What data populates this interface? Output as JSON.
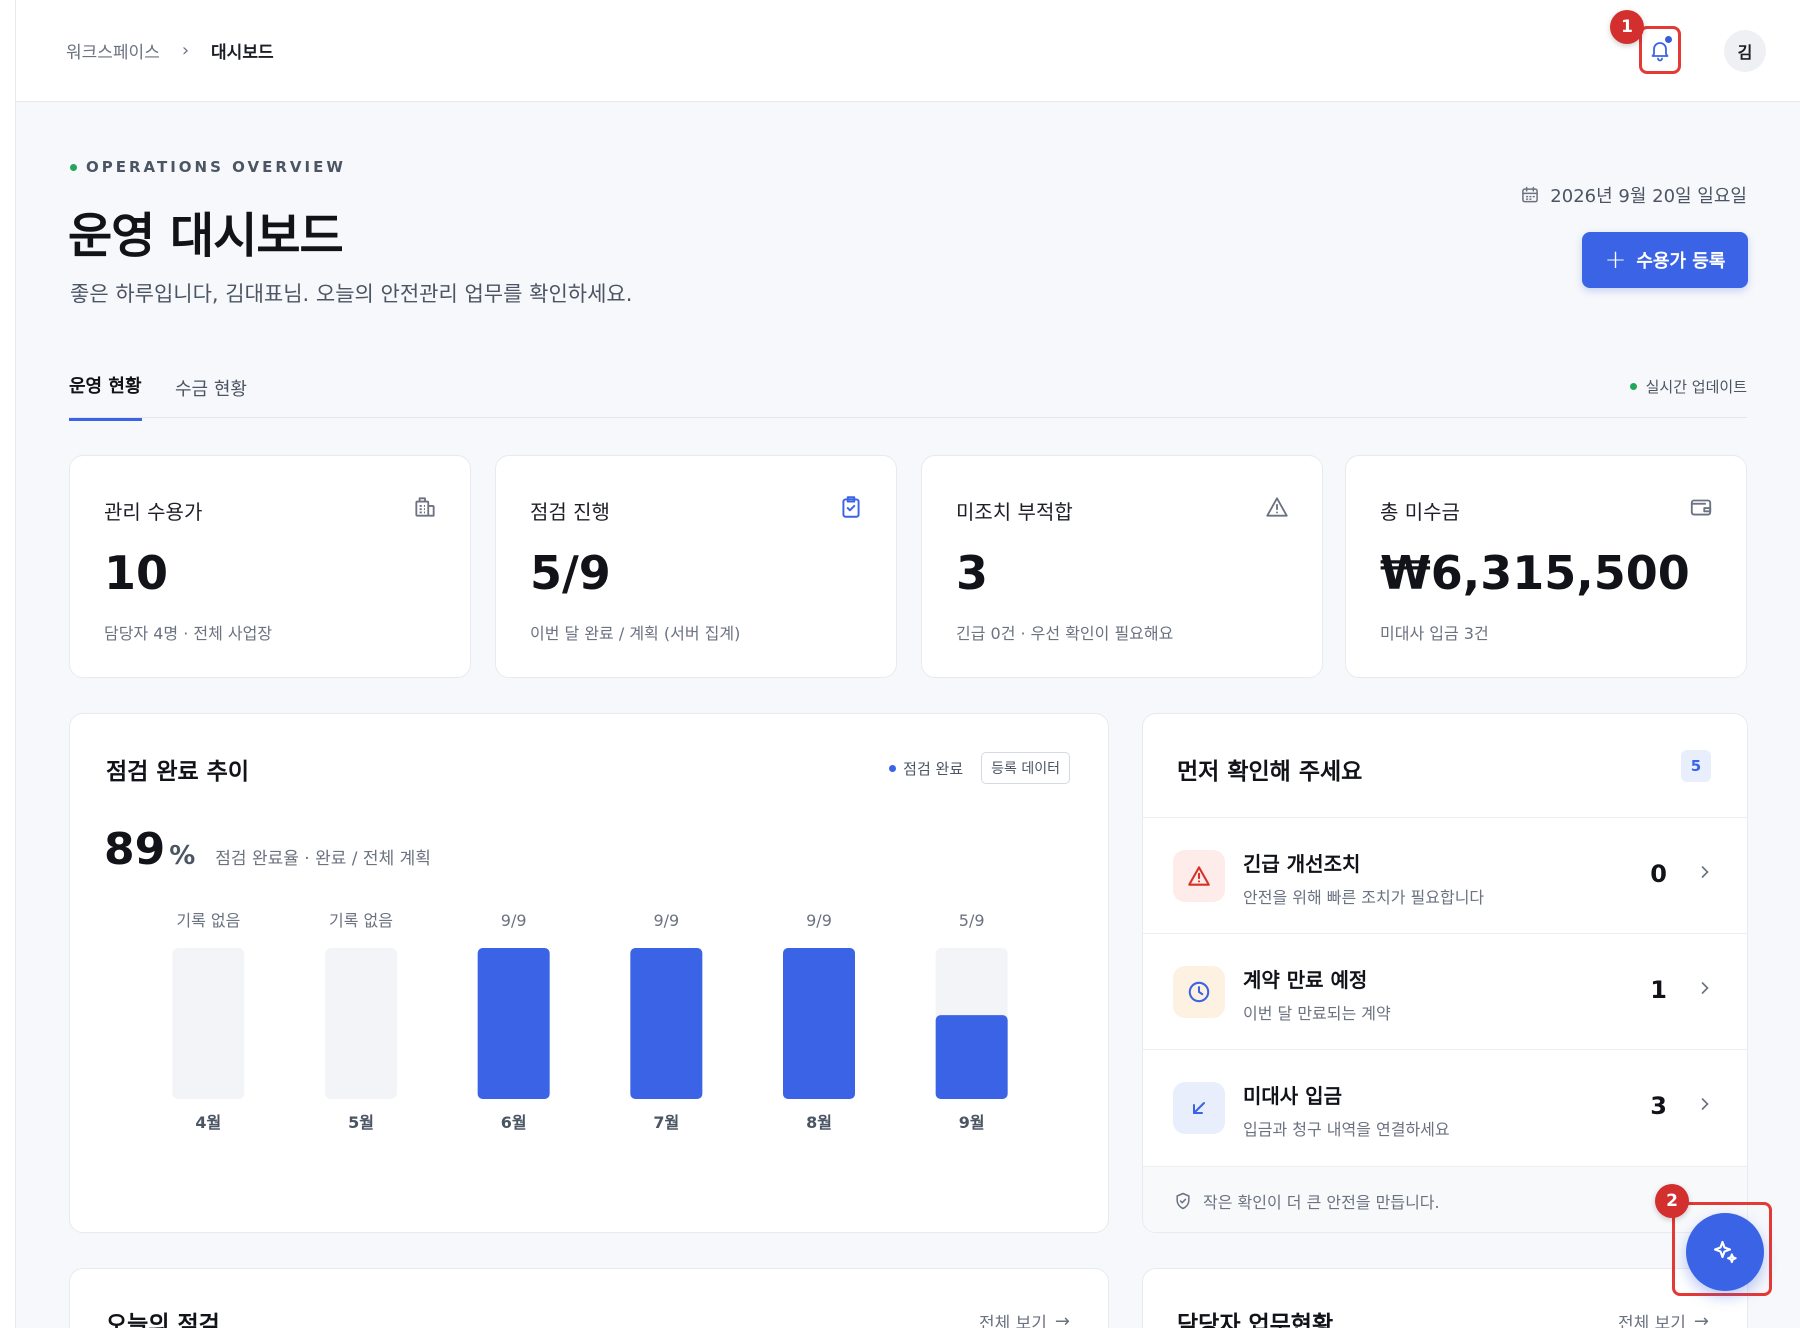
{
  "breadcrumb": {
    "root": "워크스페이스",
    "separator": "›",
    "current": "대시보드"
  },
  "header": {
    "avatar_initial": "김"
  },
  "markers": {
    "first": "1",
    "second": "2"
  },
  "hero": {
    "eyebrow": "OPERATIONS OVERVIEW",
    "title": "운영 대시보드",
    "greeting": "좋은 하루입니다, 김대표님. 오늘의 안전관리 업무를 확인하세요.",
    "date": "2026년 9월 20일 일요일",
    "primary_button": "수용가 등록"
  },
  "tabs": [
    {
      "label": "운영 현황",
      "active": true
    },
    {
      "label": "수금 현황",
      "active": false
    }
  ],
  "live_status": "실시간 업데이트",
  "stats": [
    {
      "label": "관리 수용가",
      "value": "10",
      "sub": "담당자 4명 · 전체 사업장",
      "icon": "building-icon"
    },
    {
      "label": "점검 진행",
      "value": "5/9",
      "sub": "이번 달 완료 / 계획 (서버 집계)",
      "icon": "clipboard-check-icon"
    },
    {
      "label": "미조치 부적합",
      "value": "3",
      "sub": "긴급 0건 · 우선 확인이 필요해요",
      "icon": "warning-icon"
    },
    {
      "label": "총 미수금",
      "value": "₩6,315,500",
      "sub": "미대사 입금 3건",
      "icon": "wallet-icon"
    }
  ],
  "chart_panel": {
    "title": "점검 완료 추이",
    "legend_label": "점검 완료",
    "tag": "등록 데이터",
    "rate_value": "89",
    "rate_unit": "%",
    "rate_desc": "점검 완료율 · 완료 / 전체 계획"
  },
  "chart_data": {
    "type": "bar",
    "title": "점검 완료 추이",
    "categories": [
      "4월",
      "5월",
      "6월",
      "7월",
      "8월",
      "9월"
    ],
    "series": [
      {
        "name": "점검 완료",
        "values": [
          null,
          null,
          9,
          9,
          9,
          5
        ]
      }
    ],
    "planned": [
      null,
      null,
      9,
      9,
      9,
      9
    ],
    "data_labels": [
      "기록 없음",
      "기록 없음",
      "9/9",
      "9/9",
      "9/9",
      "5/9"
    ],
    "ylim": [
      0,
      1
    ],
    "colors": {
      "bar": "#3b63e6",
      "track": "#f3f4f7"
    }
  },
  "check_panel": {
    "title": "먼저 확인해 주세요",
    "count": "5",
    "items": [
      {
        "title": "긴급 개선조치",
        "sub": "안전을 위해 빠른 조치가 필요합니다",
        "count": "0",
        "icon": "warning-icon",
        "tone": "#fdecea"
      },
      {
        "title": "계약 만료 예정",
        "sub": "이번 달 만료되는 계약",
        "count": "1",
        "icon": "clock-icon",
        "tone": "#fdf1e2"
      },
      {
        "title": "미대사 입금",
        "sub": "입금과 청구 내역을 연결하세요",
        "count": "3",
        "icon": "arrow-down-left-icon",
        "tone": "#e9eefc"
      }
    ],
    "footer": "작은 확인이 더 큰 안전을 만듭니다."
  },
  "bottom": {
    "left_title": "오늘의 점검",
    "left_link": "전체 보기",
    "right_title": "담당자 업무현황",
    "right_link": "전체 보기"
  },
  "colors": {
    "accent": "#3b63e6",
    "live": "#22a65a",
    "danger": "#e53935"
  }
}
